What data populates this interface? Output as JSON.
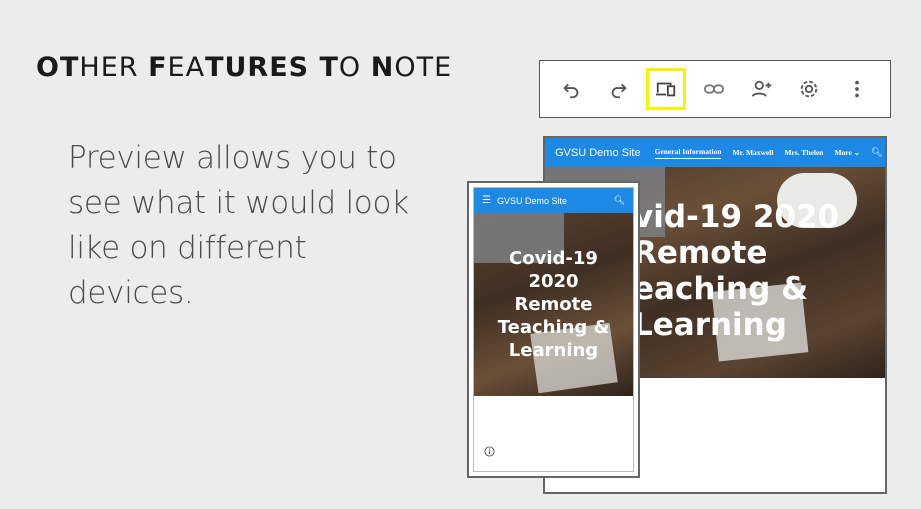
{
  "slide": {
    "title_parts": [
      {
        "text": "OT",
        "style": "b"
      },
      {
        "text": "H",
        "style": "l"
      },
      {
        "text": "ER ",
        "style": "l"
      },
      {
        "text": "F",
        "style": "b"
      },
      {
        "text": "EA",
        "style": "l"
      },
      {
        "text": "TURES ",
        "style": "b"
      },
      {
        "text": "T",
        "style": "b"
      },
      {
        "text": "O ",
        "style": "l"
      },
      {
        "text": "N",
        "style": "b"
      },
      {
        "text": "OTE",
        "style": "l"
      }
    ],
    "body_lines": [
      "Preview allows you to",
      "see what it would look",
      "like on different",
      "devices."
    ]
  },
  "toolbar": {
    "buttons": [
      {
        "name": "undo-icon",
        "label": "Undo"
      },
      {
        "name": "redo-icon",
        "label": "Redo"
      },
      {
        "name": "device-preview-icon",
        "label": "Preview",
        "selected": true
      },
      {
        "name": "link-icon",
        "label": "Copy link"
      },
      {
        "name": "add-person-icon",
        "label": "Share"
      },
      {
        "name": "gear-icon",
        "label": "Settings"
      },
      {
        "name": "more-vertical-icon",
        "label": "More"
      }
    ],
    "highlight_color": "#ffef00"
  },
  "desktop_preview": {
    "site_title": "GVSU Demo Site",
    "nav_items": [
      "General Information",
      "Mr. Maxwell",
      "Mrs. Thelen",
      "More ⌄"
    ],
    "active_nav": "General Information",
    "search_icon": "search-icon",
    "hero_title_lines": [
      "vid-19 2020",
      "Remote",
      "eaching &",
      "Learning"
    ]
  },
  "phone_preview": {
    "menu_icon": "hamburger-icon",
    "site_title": "GVSU Demo Site",
    "search_icon": "search-icon",
    "hero_title_lines": [
      "Covid-19",
      "2020",
      "Remote",
      "Teaching &",
      "Learning"
    ],
    "info_icon": "info-icon"
  },
  "colors": {
    "nav_blue": "#1e88e5",
    "background": "#ececec"
  }
}
